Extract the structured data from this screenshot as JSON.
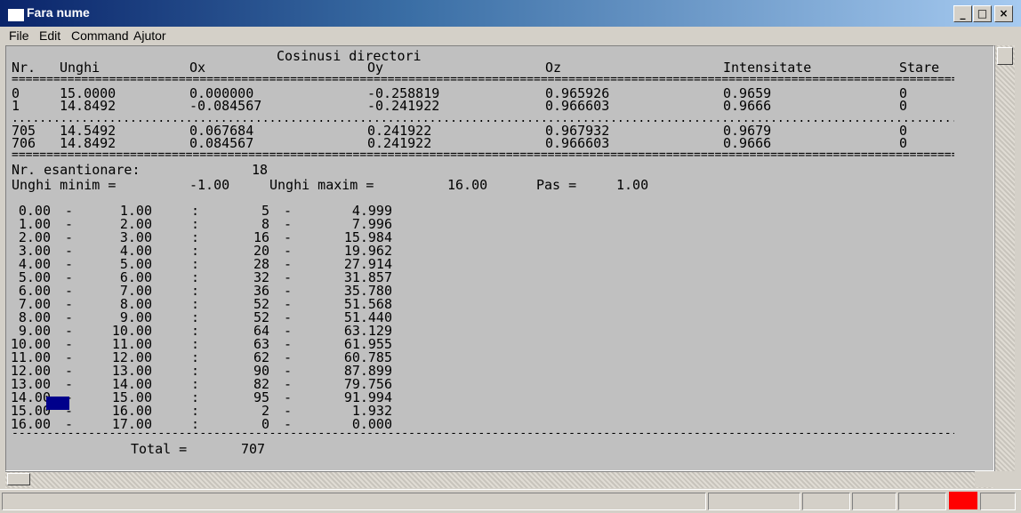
{
  "window": {
    "title": "Fara nume"
  },
  "title_buttons": {
    "minimize": "_",
    "maximize": "□",
    "close": "×"
  },
  "menu": [
    "File",
    "Edit",
    "Command",
    "Ajutor"
  ],
  "report": {
    "heading": "Cosinusi directori",
    "columns": [
      "Nr.",
      "Unghi",
      "Ox",
      "Oy",
      "Oz",
      "Intensitate",
      "Stare"
    ],
    "rows_top": [
      [
        "0",
        "15.0000",
        "0.000000",
        "-0.258819",
        "0.965926",
        "0.9659",
        "0"
      ],
      [
        "1",
        "14.8492",
        "-0.084567",
        "-0.241922",
        "0.966603",
        "0.9666",
        "0"
      ]
    ],
    "rows_bottom": [
      [
        "705",
        "14.5492",
        "0.067684",
        "0.241922",
        "0.967932",
        "0.9679",
        "0"
      ],
      [
        "706",
        "14.8492",
        "0.084567",
        "0.241922",
        "0.966603",
        "0.9666",
        "0"
      ]
    ],
    "sampling_label": "Nr. esantionare:",
    "sampling_value": "18",
    "min_label": "Unghi minim =",
    "min_value": "-1.00",
    "max_label": "Unghi maxim =",
    "max_value": "16.00",
    "step_label": "Pas =",
    "step_value": "1.00",
    "histogram": [
      [
        "0.00",
        "1.00",
        "5",
        "4.999"
      ],
      [
        "1.00",
        "2.00",
        "8",
        "7.996"
      ],
      [
        "2.00",
        "3.00",
        "16",
        "15.984"
      ],
      [
        "3.00",
        "4.00",
        "20",
        "19.962"
      ],
      [
        "4.00",
        "5.00",
        "28",
        "27.914"
      ],
      [
        "5.00",
        "6.00",
        "32",
        "31.857"
      ],
      [
        "6.00",
        "7.00",
        "36",
        "35.780"
      ],
      [
        "7.00",
        "8.00",
        "52",
        "51.568"
      ],
      [
        "8.00",
        "9.00",
        "52",
        "51.440"
      ],
      [
        "9.00",
        "10.00",
        "64",
        "63.129"
      ],
      [
        "10.00",
        "11.00",
        "63",
        "61.955"
      ],
      [
        "11.00",
        "12.00",
        "62",
        "60.785"
      ],
      [
        "12.00",
        "13.00",
        "90",
        "87.899"
      ],
      [
        "13.00",
        "14.00",
        "82",
        "79.756"
      ],
      [
        "14.00",
        "15.00",
        "95",
        "91.994"
      ],
      [
        "15.00",
        "16.00",
        "2",
        "1.932"
      ],
      [
        "16.00",
        "17.00",
        "0",
        "0.000"
      ]
    ],
    "total_label": "Total =",
    "total_value": "707"
  },
  "colors": {
    "legend_swatch": "#00008b",
    "status_indicator": "#ff0000"
  }
}
